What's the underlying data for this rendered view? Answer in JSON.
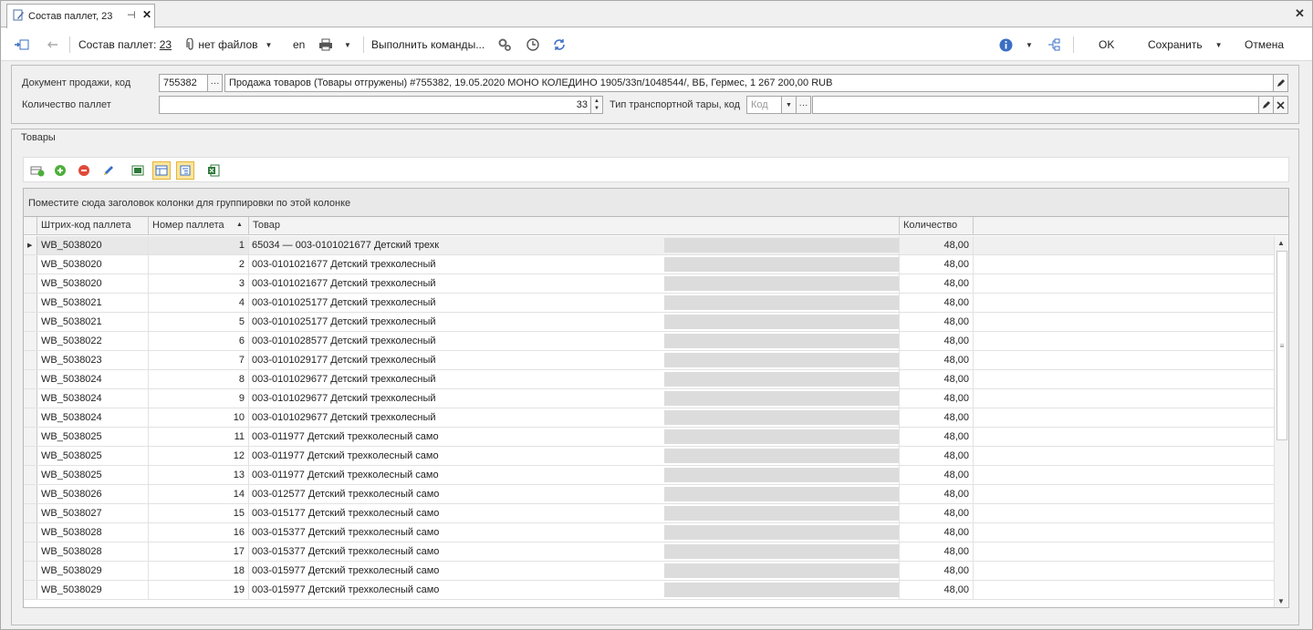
{
  "window": {
    "tab_title": "Состав паллет, 23",
    "pin_glyph": "⊣",
    "close_glyph": "✕"
  },
  "toolbar": {
    "composition_label": "Состав паллет:",
    "composition_value": "23",
    "files_label": "нет файлов",
    "language": "en",
    "commands_label": "Выполнить команды...",
    "ok_label": "OK",
    "save_label": "Сохранить",
    "cancel_label": "Отмена"
  },
  "header": {
    "sale_doc_label": "Документ продажи, код",
    "sale_doc_code": "755382",
    "sale_doc_text": "Продажа товаров (Товары отгружены) #755382, 19.05.2020 МОНО КОЛЕДИНО 1905/33п/1048544/, ВБ, Гермес, 1 267 200,00 RUB",
    "pallet_count_label": "Количество паллет",
    "pallet_count_value": "33",
    "transport_label": "Тип транспортной тары, код",
    "transport_placeholder": "Код"
  },
  "goods": {
    "caption": "Товары",
    "group_panel_text": "Поместите сюда заголовок колонки для группировки по этой колонке",
    "columns": [
      "Штрих-код паллета",
      "Номер паллета",
      "Товар",
      "Количество"
    ],
    "rows": [
      {
        "barcode": "WB_5038020",
        "number": "1",
        "product": "65034 — 003-0101021677 Детский трехк",
        "qty": "48,00"
      },
      {
        "barcode": "WB_5038020",
        "number": "2",
        "product": "003-0101021677 Детский трехколесный",
        "qty": "48,00"
      },
      {
        "barcode": "WB_5038020",
        "number": "3",
        "product": "003-0101021677 Детский трехколесный",
        "qty": "48,00"
      },
      {
        "barcode": "WB_5038021",
        "number": "4",
        "product": "003-0101025177 Детский трехколесный",
        "qty": "48,00"
      },
      {
        "barcode": "WB_5038021",
        "number": "5",
        "product": "003-0101025177 Детский трехколесный",
        "qty": "48,00"
      },
      {
        "barcode": "WB_5038022",
        "number": "6",
        "product": "003-0101028577 Детский трехколесный",
        "qty": "48,00"
      },
      {
        "barcode": "WB_5038023",
        "number": "7",
        "product": "003-0101029177 Детский трехколесный",
        "qty": "48,00"
      },
      {
        "barcode": "WB_5038024",
        "number": "8",
        "product": "003-0101029677 Детский трехколесный",
        "qty": "48,00"
      },
      {
        "barcode": "WB_5038024",
        "number": "9",
        "product": "003-0101029677 Детский трехколесный",
        "qty": "48,00"
      },
      {
        "barcode": "WB_5038024",
        "number": "10",
        "product": "003-0101029677 Детский трехколесный",
        "qty": "48,00"
      },
      {
        "barcode": "WB_5038025",
        "number": "11",
        "product": "003-011977 Детский трехколесный само",
        "qty": "48,00"
      },
      {
        "barcode": "WB_5038025",
        "number": "12",
        "product": "003-011977 Детский трехколесный само",
        "qty": "48,00"
      },
      {
        "barcode": "WB_5038025",
        "number": "13",
        "product": "003-011977 Детский трехколесный само",
        "qty": "48,00"
      },
      {
        "barcode": "WB_5038026",
        "number": "14",
        "product": "003-012577 Детский трехколесный само",
        "qty": "48,00"
      },
      {
        "barcode": "WB_5038027",
        "number": "15",
        "product": "003-015177 Детский трехколесный само",
        "qty": "48,00"
      },
      {
        "barcode": "WB_5038028",
        "number": "16",
        "product": "003-015377 Детский трехколесный само",
        "qty": "48,00"
      },
      {
        "barcode": "WB_5038028",
        "number": "17",
        "product": "003-015377 Детский трехколесный само",
        "qty": "48,00"
      },
      {
        "barcode": "WB_5038029",
        "number": "18",
        "product": "003-015977 Детский трехколесный само",
        "qty": "48,00"
      },
      {
        "barcode": "WB_5038029",
        "number": "19",
        "product": "003-015977 Детский трехколесный само",
        "qty": "48,00"
      }
    ]
  },
  "icons": {
    "tab": "edit-document-icon",
    "toolbar": [
      "new-record-icon",
      "undo-icon",
      "attach-icon",
      "print-icon",
      "settings-icon",
      "history-icon",
      "refresh-icon",
      "info-icon",
      "tree-icon"
    ],
    "goods_toolbar": [
      "add-row-icon",
      "add-icon",
      "remove-icon",
      "edit-icon",
      "view-icon",
      "columns-icon",
      "tree-view-icon",
      "excel-icon"
    ]
  },
  "colors": {
    "active_toggle": "#fbe59a",
    "add_green": "#4caf3a",
    "remove_red": "#e04a3a",
    "info_blue": "#3a6fc4"
  }
}
